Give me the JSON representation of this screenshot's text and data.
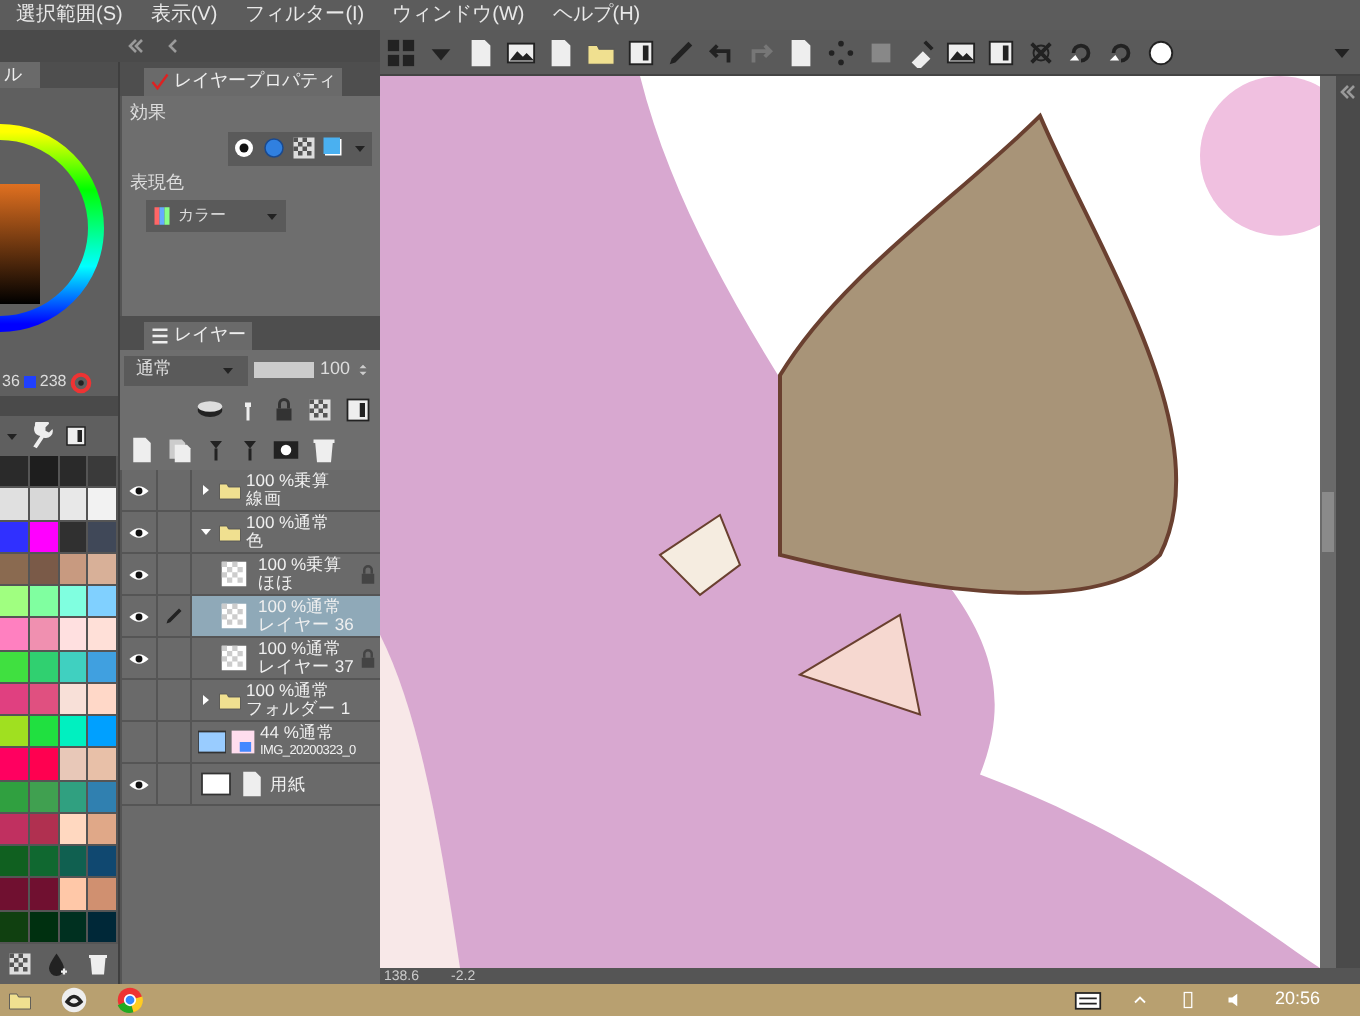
{
  "menu": [
    "選択範囲(S)",
    "表示(V)",
    "フィルター(I)",
    "ウィンドウ(W)",
    "ヘルプ(H)"
  ],
  "color_panel": {
    "tab": "ル",
    "readout_1": "36",
    "readout_2": "238"
  },
  "palette": {
    "rows": [
      {
        "swatches": [
          {
            "color": "#2a2a2a"
          },
          {
            "color": "#1e1e1e"
          },
          {
            "color": "#2a2a2a"
          },
          {
            "color": "#3a3a3a"
          }
        ]
      },
      {
        "swatches": [
          {
            "color": "#e0e0e0"
          },
          {
            "color": "#d8d8d8"
          },
          {
            "color": "#e8e8e8"
          },
          {
            "color": "#f2f2f2"
          }
        ]
      },
      {
        "swatches": [
          {
            "color": "#3030ff"
          },
          {
            "color": "#ff00ff"
          },
          {
            "color": "#303030"
          },
          {
            "color": "#404858"
          }
        ]
      },
      {
        "swatches": [
          {
            "color": "#8a6a50"
          },
          {
            "color": "#7a5a48"
          },
          {
            "color": "#c89a80"
          },
          {
            "color": "#d8b098"
          }
        ]
      },
      {
        "swatches": [
          {
            "color": "#a0ff80"
          },
          {
            "color": "#80ffa0"
          },
          {
            "color": "#80ffe0"
          },
          {
            "color": "#80d0ff"
          }
        ]
      },
      {
        "swatches": [
          {
            "color": "#ff80c0"
          },
          {
            "color": "#f090b0"
          },
          {
            "color": "#ffe0e0"
          },
          {
            "color": "#ffe0d8"
          }
        ]
      },
      {
        "swatches": [
          {
            "color": "#40e040"
          },
          {
            "color": "#30d070"
          },
          {
            "color": "#40d0c0"
          },
          {
            "color": "#40a0e0"
          }
        ]
      },
      {
        "swatches": [
          {
            "color": "#e04080"
          },
          {
            "color": "#e05080"
          },
          {
            "color": "#f8e0d8"
          },
          {
            "color": "#ffd8c8"
          }
        ]
      },
      {
        "swatches": [
          {
            "color": "#a0e020"
          },
          {
            "color": "#20e040"
          },
          {
            "color": "#00f0c0"
          },
          {
            "color": "#00a0ff"
          }
        ]
      },
      {
        "swatches": [
          {
            "color": "#ff0060"
          },
          {
            "color": "#ff0050"
          },
          {
            "color": "#e8c8b8"
          },
          {
            "color": "#e8c0a8"
          }
        ]
      },
      {
        "swatches": [
          {
            "color": "#30a040"
          },
          {
            "color": "#40a050"
          },
          {
            "color": "#30a080"
          },
          {
            "color": "#3080b0"
          }
        ]
      },
      {
        "swatches": [
          {
            "color": "#c03060"
          },
          {
            "color": "#b03050"
          },
          {
            "color": "#ffd8c0"
          },
          {
            "color": "#e0a888"
          }
        ]
      },
      {
        "swatches": [
          {
            "color": "#106020"
          },
          {
            "color": "#106830"
          },
          {
            "color": "#106050"
          },
          {
            "color": "#104870"
          }
        ]
      },
      {
        "swatches": [
          {
            "color": "#701030"
          },
          {
            "color": "#701030"
          },
          {
            "color": "#ffc8a8"
          },
          {
            "color": "#d09070"
          }
        ]
      },
      {
        "swatches": [
          {
            "color": "#104010"
          },
          {
            "color": "#003010"
          },
          {
            "color": "#003020"
          },
          {
            "color": "#002838"
          }
        ]
      }
    ]
  },
  "layer_property": {
    "tab": "レイヤープロパティ",
    "effect_label": "効果",
    "color_label": "表現色",
    "color_mode": "カラー"
  },
  "layer_panel": {
    "tab": "レイヤー",
    "blend_mode": "通常",
    "opacity_slider": {
      "level": 1
    },
    "opacity": "100",
    "layers": [
      {
        "kind": "folder",
        "visible": true,
        "selected": false,
        "locked": false,
        "expanded": false,
        "mode": "100 %乗算",
        "name": "線画"
      },
      {
        "kind": "folder",
        "visible": true,
        "selected": false,
        "locked": false,
        "expanded": true,
        "mode": "100 %通常",
        "name": "色",
        "children": [
          {
            "kind": "raster",
            "visible": true,
            "selected": false,
            "locked": true,
            "mode": "100 %乗算",
            "name": "ほほ"
          },
          {
            "kind": "raster",
            "visible": true,
            "selected": true,
            "locked": false,
            "mode": "100 %通常",
            "name": "レイヤー 36"
          },
          {
            "kind": "raster",
            "visible": true,
            "selected": false,
            "locked": true,
            "mode": "100 %通常",
            "name": "レイヤー 37"
          }
        ]
      },
      {
        "kind": "folder",
        "visible": false,
        "selected": false,
        "locked": false,
        "expanded": false,
        "mode": "100 %通常",
        "name": "フォルダー 1"
      },
      {
        "kind": "image",
        "visible": false,
        "selected": false,
        "locked": false,
        "mode": "44 %通常",
        "name": "IMG_20200323_0"
      },
      {
        "kind": "paper",
        "visible": true,
        "selected": false,
        "locked": false,
        "name": "用紙"
      }
    ]
  },
  "canvas_status": {
    "zoom": "138.6",
    "angle": "-2.2"
  },
  "taskbar": {
    "time": "20:56"
  }
}
